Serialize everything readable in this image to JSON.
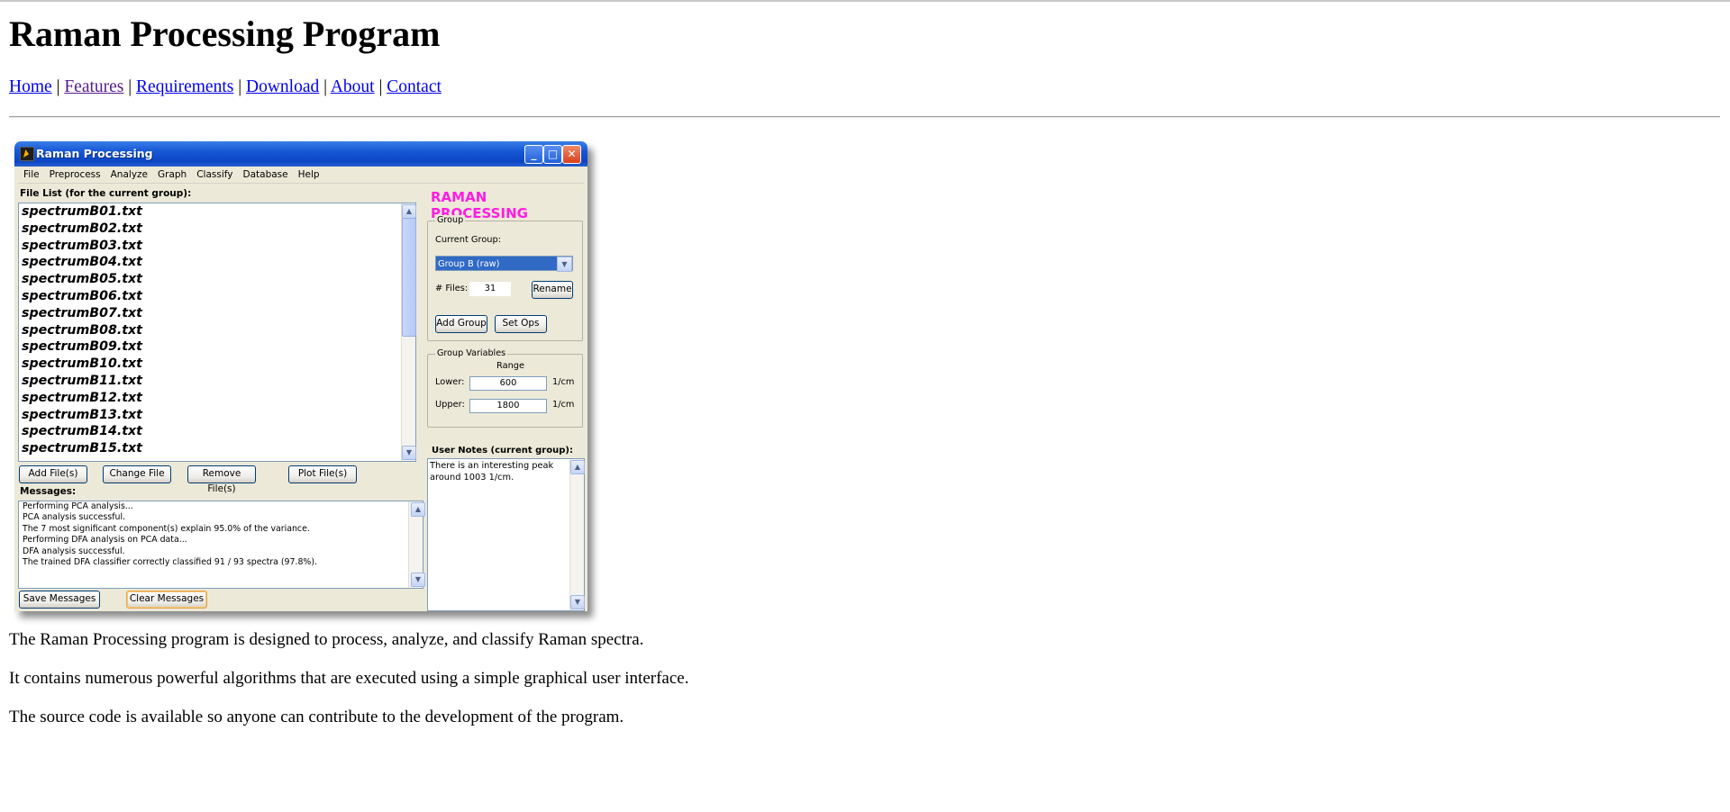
{
  "page": {
    "title": "Raman Processing Program",
    "nav": [
      {
        "label": "Home",
        "visited": false
      },
      {
        "label": "Features",
        "visited": true
      },
      {
        "label": "Requirements",
        "visited": false
      },
      {
        "label": "Download",
        "visited": false
      },
      {
        "label": "About",
        "visited": false
      },
      {
        "label": "Contact",
        "visited": false
      }
    ],
    "nav_separator": "|",
    "paragraphs": [
      "The Raman Processing program is designed to process, analyze, and classify Raman spectra.",
      "It contains numerous powerful algorithms that are executed using a simple graphical user interface.",
      "The source code is available so anyone can contribute to the development of the program."
    ]
  },
  "app": {
    "window_title": "Raman Processing",
    "menu": [
      "File",
      "Preprocess",
      "Analyze",
      "Graph",
      "Classify",
      "Database",
      "Help"
    ],
    "file_list_label": "File List (for the current group):",
    "files": [
      "spectrumB01.txt",
      "spectrumB02.txt",
      "spectrumB03.txt",
      "spectrumB04.txt",
      "spectrumB05.txt",
      "spectrumB06.txt",
      "spectrumB07.txt",
      "spectrumB08.txt",
      "spectrumB09.txt",
      "spectrumB10.txt",
      "spectrumB11.txt",
      "spectrumB12.txt",
      "spectrumB13.txt",
      "spectrumB14.txt",
      "spectrumB15.txt"
    ],
    "file_buttons": {
      "add": "Add File(s)",
      "change": "Change File",
      "remove": "Remove File(s)",
      "plot": "Plot File(s)"
    },
    "messages_label": "Messages:",
    "messages": [
      "Performing PCA analysis...",
      "PCA analysis successful.",
      "The 7 most significant component(s) explain 95.0% of the variance.",
      "Performing DFA analysis on PCA data...",
      "DFA analysis successful.",
      "The trained DFA classifier correctly classified 91 / 93 spectra (97.8%)."
    ],
    "message_buttons": {
      "save": "Save Messages",
      "clear": "Clear Messages"
    },
    "brand": "RAMAN PROCESSING",
    "brand_color": "#ff1de1",
    "group": {
      "legend": "Group",
      "current_label": "Current Group:",
      "current_value": "Group B (raw)",
      "files_label": "# Files:",
      "files_value": "31",
      "rename": "Rename",
      "add_group": "Add Group",
      "set_ops": "Set Ops"
    },
    "group_variables": {
      "legend": "Group Variables",
      "range_label": "Range",
      "lower_label": "Lower:",
      "lower_value": "600",
      "upper_label": "Upper:",
      "upper_value": "1800",
      "unit": "1/cm"
    },
    "notes_label": "User Notes (current group):",
    "notes_text": "There is an interesting peak around 1003 1/cm."
  }
}
